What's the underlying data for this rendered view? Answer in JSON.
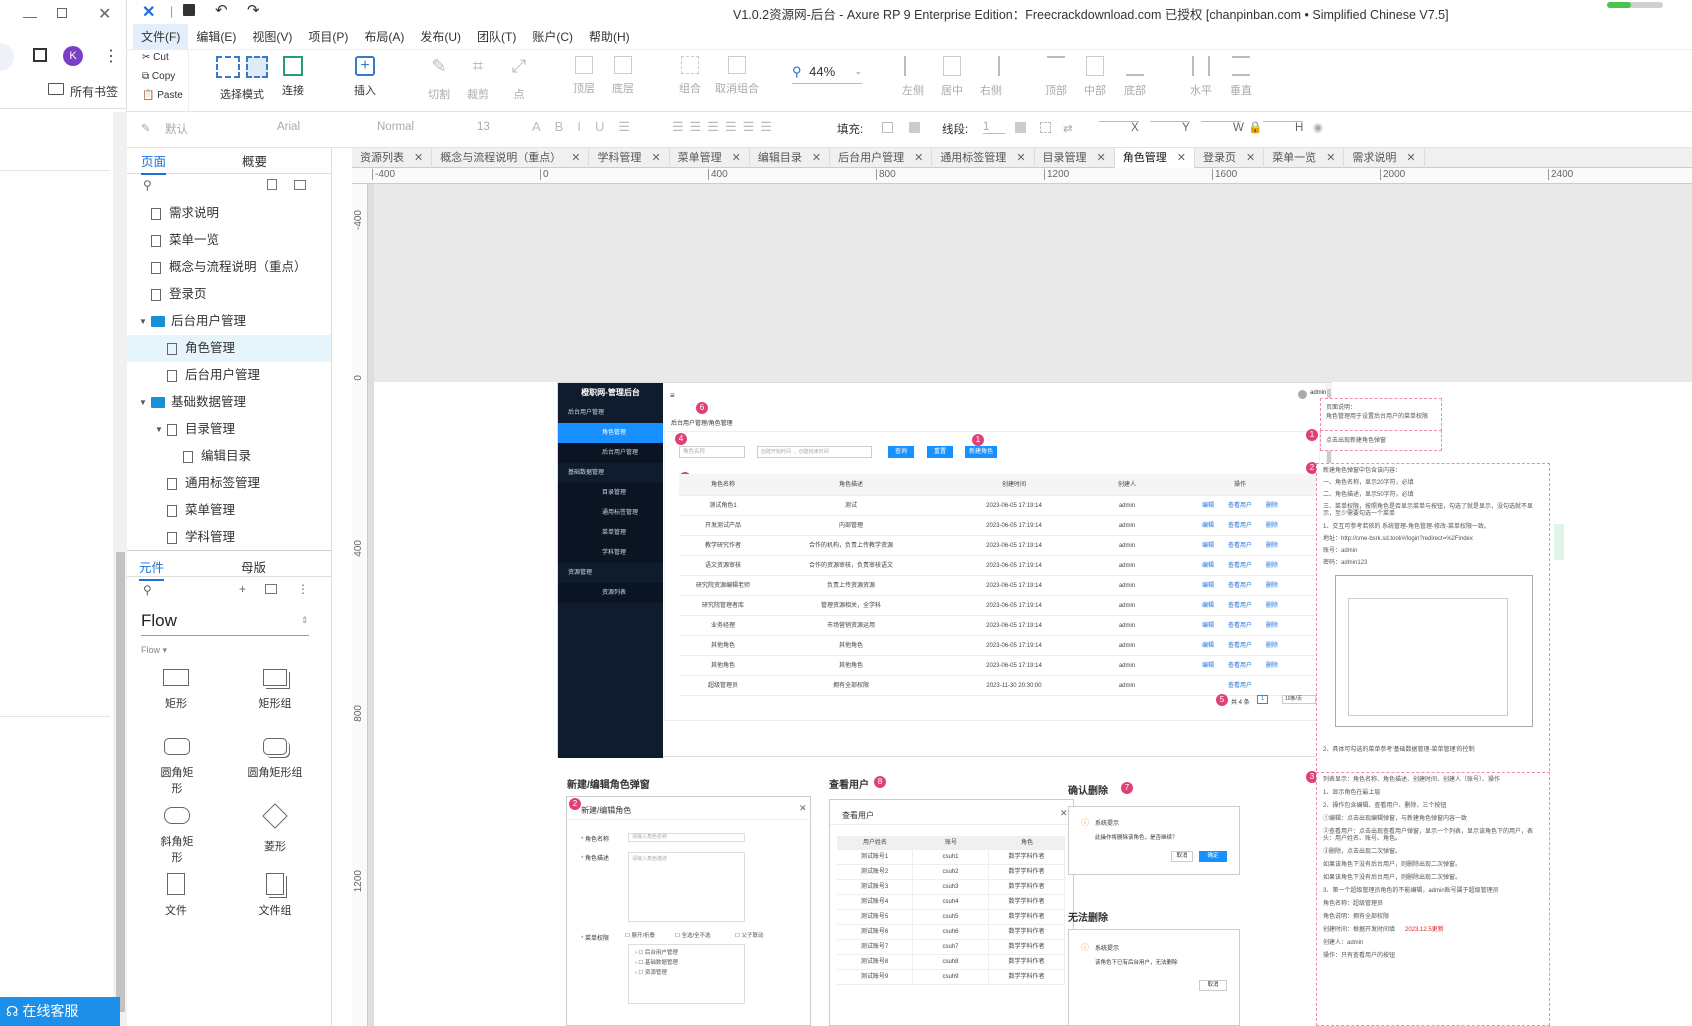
{
  "app": {
    "title": "V1.0.2资源网-后台 - Axure RP 9 Enterprise Edition：Freecrackdownload.com 已授权    [chanpinban.com • Simplified Chinese V7.5]"
  },
  "browser": {
    "avatar_letter": "K",
    "bookmarks_label": "所有书签",
    "service_label": "在线客服"
  },
  "menu": [
    "文件(F)",
    "编辑(E)",
    "视图(V)",
    "项目(P)",
    "布局(A)",
    "发布(U)",
    "团队(T)",
    "账户(C)",
    "帮助(H)"
  ],
  "clipboard": {
    "cut": "Cut",
    "copy": "Copy",
    "paste": "Paste"
  },
  "toolbar": {
    "select_mode": "选择模式",
    "connect": "连接",
    "insert": "插入",
    "cut": "切割",
    "crop": "裁剪",
    "point": "点",
    "top_layer": "顶层",
    "bottom_layer": "底层",
    "group": "组合",
    "ungroup": "取消组合",
    "zoom": "44%",
    "align_left": "左侧",
    "align_center": "居中",
    "align_right": "右侧",
    "align_top": "顶部",
    "align_middle": "中部",
    "align_bottom": "底部",
    "distribute_h": "水平",
    "distribute_v": "垂直"
  },
  "format": {
    "style": "默认",
    "font": "Arial",
    "weight": "Normal",
    "size": "13",
    "fill_label": "填充:",
    "stroke_label": "线段:",
    "stroke_value": "1",
    "x": "X",
    "y": "Y",
    "w": "W",
    "h": "H"
  },
  "left_panel": {
    "tabs": [
      "页面",
      "概要"
    ],
    "pages": [
      {
        "label": "需求说明",
        "type": "page",
        "indent": 0
      },
      {
        "label": "菜单一览",
        "type": "page",
        "indent": 0
      },
      {
        "label": "概念与流程说明（重点）",
        "type": "page",
        "indent": 0
      },
      {
        "label": "登录页",
        "type": "page",
        "indent": 0
      },
      {
        "label": "后台用户管理",
        "type": "folder",
        "indent": 0
      },
      {
        "label": "角色管理",
        "type": "page",
        "indent": 1,
        "selected": true
      },
      {
        "label": "后台用户管理",
        "type": "page",
        "indent": 1
      },
      {
        "label": "基础数据管理",
        "type": "folder",
        "indent": 0
      },
      {
        "label": "目录管理",
        "type": "page",
        "indent": 1
      },
      {
        "label": "编辑目录",
        "type": "page",
        "indent": 2
      },
      {
        "label": "通用标签管理",
        "type": "page",
        "indent": 1
      },
      {
        "label": "菜单管理",
        "type": "page",
        "indent": 1
      },
      {
        "label": "学科管理",
        "type": "page",
        "indent": 1
      },
      {
        "label": "资源管理",
        "type": "folder",
        "indent": 0
      }
    ],
    "lib_tabs": [
      "元件",
      "母版"
    ],
    "library": "Flow",
    "library_sub": "Flow ▾",
    "widgets": [
      "矩形",
      "矩形组",
      "圆角矩形",
      "圆角矩形组",
      "斜角矩形",
      "菱形",
      "文件",
      "文件组"
    ]
  },
  "tabs": [
    "资源列表",
    "概念与流程说明（重点）",
    "学科管理",
    "菜单管理",
    "编辑目录",
    "后台用户管理",
    "通用标签管理",
    "目录管理",
    "角色管理",
    "登录页",
    "菜单一览",
    "需求说明"
  ],
  "active_tab": "角色管理",
  "ruler_top": [
    "-400",
    "0",
    "400",
    "800",
    "1200",
    "1600",
    "2000",
    "2400"
  ],
  "ruler_left": [
    "-400",
    "0",
    "400",
    "800",
    "1200"
  ],
  "proto": {
    "brand": "橙职网-管理后台",
    "admin": "admin",
    "breadcrumb": "后台用户管理/角色管理",
    "side_groups": [
      {
        "label": "后台用户管理",
        "items": [
          "角色管理",
          "后台用户管理"
        ]
      },
      {
        "label": "基础数据管理",
        "items": [
          "目录管理",
          "通用标签管理",
          "菜单管理",
          "学科管理"
        ]
      },
      {
        "label": "资源管理",
        "items": [
          "资源列表"
        ]
      }
    ],
    "search_placeholder": "角色名称",
    "date_start": "创建开始时间",
    "date_end": "创建结束时间",
    "btn_query": "查询",
    "btn_reset": "重置",
    "btn_new": "新建角色",
    "columns": [
      "角色名称",
      "角色描述",
      "创建时间",
      "创建人",
      "操作"
    ],
    "rows": [
      [
        "测试角色1",
        "测试",
        "2023-06-05 17:19:14",
        "admin"
      ],
      [
        "开发测试产品",
        "内部管理",
        "2023-06-05 17:19:14",
        "admin"
      ],
      [
        "教学研究作者",
        "合作的机构，负责上传教学资源",
        "2023-06-05 17:19:14",
        "admin"
      ],
      [
        "语文资源审核",
        "合作的资源审核，负责审核语文",
        "2023-06-05 17:19:14",
        "admin"
      ],
      [
        "研究院资源编辑老师",
        "负责上传资源资源",
        "2023-06-05 17:19:14",
        "admin"
      ],
      [
        "研究院管理者库",
        "管理资源相关，全学科",
        "2023-06-05 17:19:14",
        "admin"
      ],
      [
        "业务经理",
        "市场营销资源运用",
        "2023-06-05 17:19:14",
        "admin"
      ],
      [
        "其他角色",
        "其他角色",
        "2023-06-05 17:19:14",
        "admin"
      ],
      [
        "其他角色",
        "其他角色",
        "2023-06-05 17:19:14",
        "admin"
      ],
      [
        "超级管理员",
        "拥有全部权限",
        "2023-11-30 20:30:00",
        "admin"
      ]
    ],
    "ops": [
      "编辑",
      "查看用户",
      "删除"
    ],
    "pagination": "共 4 条",
    "page_size": "10条/页",
    "dialog_edit_title": "新建/编辑角色弹窗",
    "dialog_edit_header": "新建/编辑角色",
    "field_name": "角色名称",
    "field_name_ph": "请输入角色名称",
    "field_desc": "角色描述",
    "field_desc_ph": "请输入角色描述",
    "field_menu": "菜单权限",
    "menu_opts": [
      "展开/折叠",
      "全选/全不选",
      "父子联动"
    ],
    "menu_tree": [
      "后台用户管理",
      "基础数据管理",
      "资源管理"
    ],
    "dialog_users_title": "查看用户",
    "dialog_users_header": "查看用户",
    "users_cols": [
      "用户姓名",
      "账号",
      "角色"
    ],
    "users_rows": [
      [
        "测试账号1",
        "csuh1",
        "数学学科作者"
      ],
      [
        "测试账号2",
        "csuh2",
        "数学学科作者"
      ],
      [
        "测试账号3",
        "csuh3",
        "数学学科作者"
      ],
      [
        "测试账号4",
        "csuh4",
        "数学学科作者"
      ],
      [
        "测试账号5",
        "csuh5",
        "数学学科作者"
      ],
      [
        "测试账号6",
        "csuh6",
        "数学学科作者"
      ],
      [
        "测试账号7",
        "csuh7",
        "数学学科作者"
      ],
      [
        "测试账号8",
        "csuh8",
        "数学学科作者"
      ],
      [
        "测试账号9",
        "csuh9",
        "数学学科作者"
      ]
    ],
    "confirm_title": "确认删除",
    "confirm_header": "系统提示",
    "confirm_text": "此操作将删除该角色，是否继续？",
    "confirm_cancel": "取消",
    "confirm_ok": "确定",
    "nodel_title": "无法删除",
    "nodel_header": "系统提示",
    "nodel_text": "该角色下已有后台用户，无法删除",
    "nodel_btn": "取消"
  },
  "annotations": {
    "a0_title": "页面说明：",
    "a0_text": "角色管理用于设置后台用户的菜单权限",
    "a1_text": "点击出现新建角色弹窗",
    "a2_lines": [
      "新建角色弹窗中包含该内容：",
      "一、角色名称，显示20字符，必填",
      "二、角色描述，显示50字符，必填",
      "三、菜单权限，按照角色是否显示菜单与按钮，勾选了就是显示，没勾选就不显示，至少需要勾选一个菜单",
      "1、交互可参考若依的 系统管理-角色管理-修改-菜单权限一致。",
      "地址：http://cme-bsrk.sd.tool/#/login?redirect=%2Findex",
      "账号：admin",
      "密码：admin123",
      "2、具体可勾选的菜单参考'基础数据管理-菜单管理'的控制"
    ],
    "a3_lines": [
      "列表显示：角色名称、角色描述、创建时间、创建人（账号）、操作",
      "1、显示角色在最上层",
      "2、操作包含编辑、查看用户、删除，三个按钮",
      "①编辑：点击出现编辑弹窗，与新建角色弹窗内容一致",
      "②查看用户：点击出现查看用户弹窗，显示一个列表，显示该角色下的用户，表头：用户姓名、账号、角色。",
      "③删除，点击出现二次弹窗。",
      "如果该角色下没有后台用户，则删除出现二次弹窗。",
      "如果该角色下没有后台用户，则删除出现二次弹窗。",
      "3、第一个超级管理员角色的不能编辑，admin账号属于超级管理员",
      "角色名称：超级管理员",
      "角色说明：拥有全部权限",
      "创建时间：根据开发时间填",
      "创建人：admin",
      "操作：只有查看用户的按钮"
    ],
    "a3_red": "2023.12.5更新"
  },
  "colors": {
    "accent": "#1890ff",
    "pin": "#e0407a",
    "side": "#0f1c2e"
  }
}
